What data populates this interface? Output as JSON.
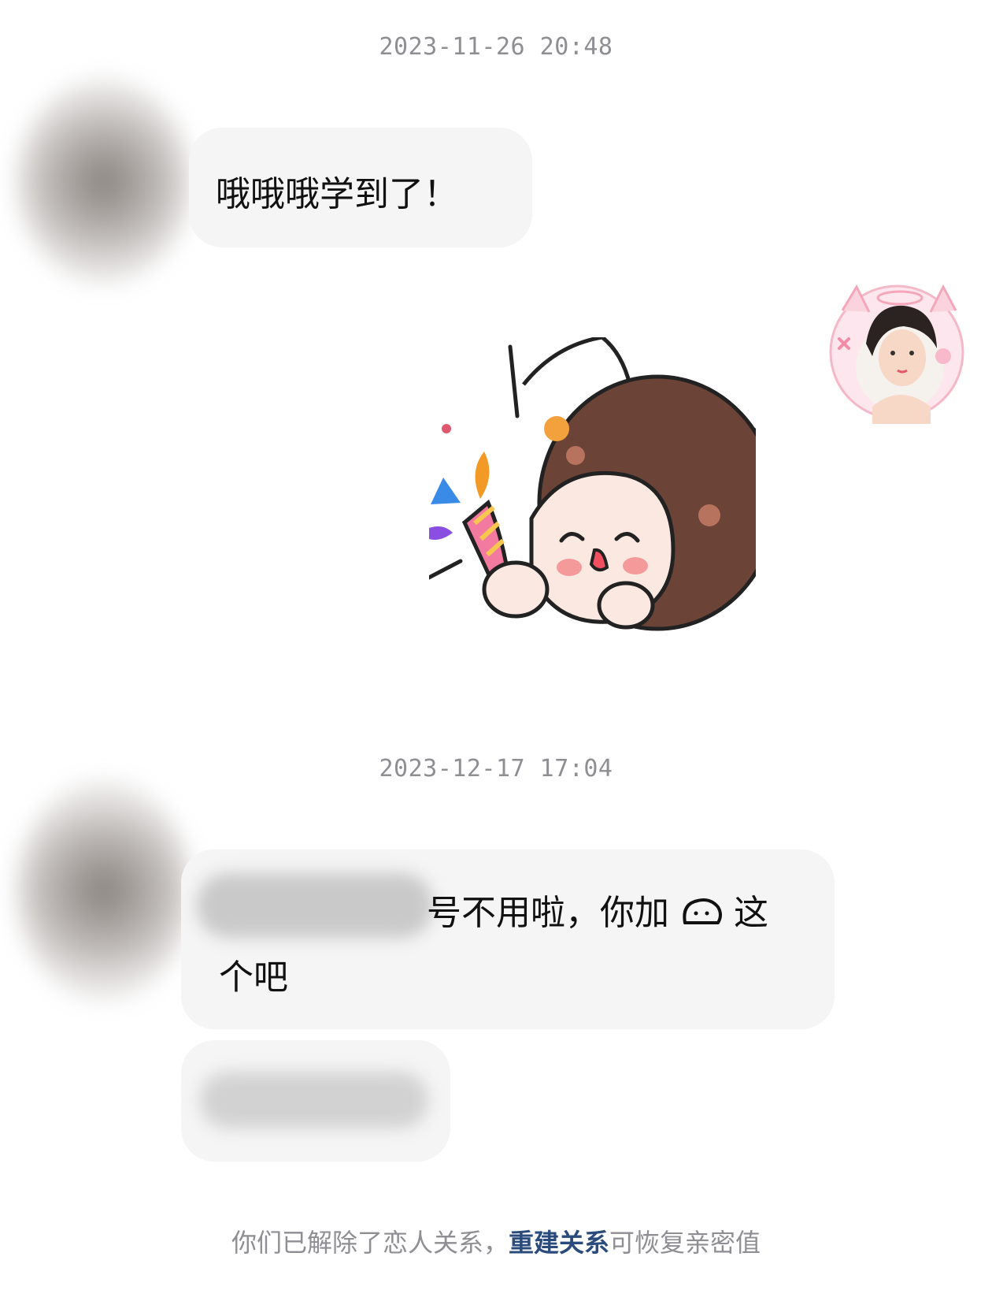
{
  "messages": {
    "timestamp_1": "2023-11-26  20:48",
    "incoming_1": "哦哦哦学到了！",
    "timestamp_2": "2023-12-17  17:04",
    "incoming_2_line1_tail": "号不用啦，你加",
    "incoming_2_line1_end": "这",
    "incoming_2_line2": "个吧"
  },
  "footer": {
    "prefix": "你们已解除了恋人关系，",
    "link": "重建关系",
    "suffix": "可恢复亲密值"
  },
  "colors": {
    "bubble_bg": "#f5f5f5",
    "timestamp": "#8e8e93",
    "link": "#2a4b7c"
  },
  "icons": {
    "sticker": "party-popper-girl-sticker",
    "inline_emoji": "bun-face-emoji"
  }
}
